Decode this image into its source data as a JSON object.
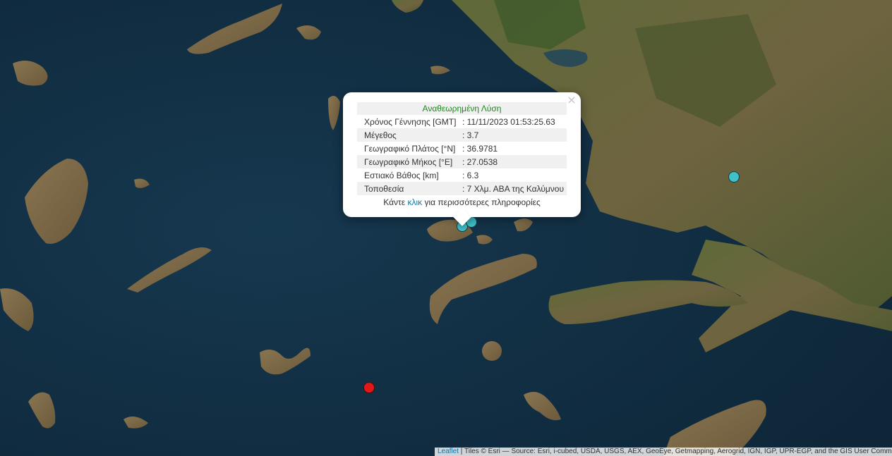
{
  "map": {
    "basemap": "satellite imagery",
    "sea_color": "#12324a",
    "land_color": "#6f6440",
    "vegetation_color": "#3f5a2c"
  },
  "markers": [
    {
      "name": "quake-kalymnos-1",
      "color": "#3ec1c9"
    },
    {
      "name": "quake-kalymnos-2",
      "color": "#3ec1c9"
    },
    {
      "name": "quake-turkey-inland",
      "color": "#3ec1c9"
    },
    {
      "name": "quake-south-aegean",
      "color": "#e01818"
    }
  ],
  "popup": {
    "heading": "Αναθεωρημένη Λύση",
    "rows": [
      {
        "key": "Χρόνος Γέννησης [GMT]",
        "value": ": 11/11/2023 01:53:25.63"
      },
      {
        "key": "Μέγεθος",
        "value": ": 3.7"
      },
      {
        "key": "Γεωγραφικό Πλάτος [°N]",
        "value": ": 36.9781"
      },
      {
        "key": "Γεωγραφικό Μήκος [°E]",
        "value": ": 27.0538"
      },
      {
        "key": "Εστιακό Βάθος [km]",
        "value": ": 6.3"
      },
      {
        "key": "Τοποθεσία",
        "value": ": 7 Χλμ. ΑΒΑ της Καλύμνου"
      }
    ],
    "more_prefix": "Κάντε ",
    "more_link": "κλικ",
    "more_suffix": " για περισσότερες πληροφορίες",
    "close_icon": "×"
  },
  "attribution": {
    "leaflet": "Leaflet",
    "rest": " | Tiles © Esri — Source: Esri, i-cubed, USDA, USGS, AEX, GeoEye, Getmapping, Aerogrid, IGN, IGP, UPR-EGP, and the GIS User Community"
  }
}
